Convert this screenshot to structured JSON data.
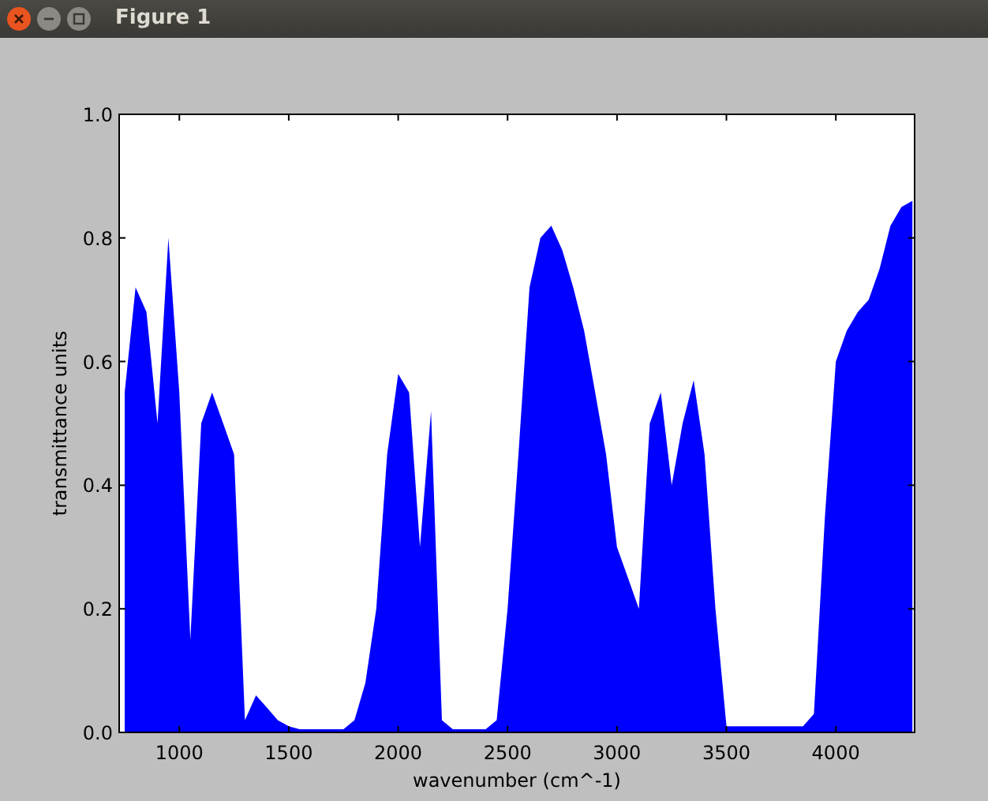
{
  "window": {
    "title": "Figure 1"
  },
  "figure": {
    "chart_data": {
      "type": "area",
      "xlabel": "wavenumber (cm^-1)",
      "ylabel": "transmittance units",
      "xlim": [
        725,
        4360
      ],
      "ylim": [
        0,
        1
      ],
      "xticks": [
        1000,
        1500,
        2000,
        2500,
        3000,
        3500,
        4000
      ],
      "yticks": [
        {
          "value": 0,
          "label": "0.0"
        },
        {
          "value": 0.2,
          "label": "0.2"
        },
        {
          "value": 0.4,
          "label": "0.4"
        },
        {
          "value": 0.6,
          "label": "0.6"
        },
        {
          "value": 0.8,
          "label": "0.8"
        },
        {
          "value": 1,
          "label": "1.0"
        }
      ],
      "x": [
        750,
        800,
        850,
        900,
        950,
        1000,
        1050,
        1100,
        1150,
        1200,
        1250,
        1300,
        1350,
        1400,
        1450,
        1500,
        1550,
        1600,
        1650,
        1700,
        1750,
        1800,
        1850,
        1900,
        1950,
        2000,
        2050,
        2100,
        2150,
        2200,
        2250,
        2300,
        2350,
        2400,
        2450,
        2500,
        2550,
        2600,
        2650,
        2700,
        2750,
        2800,
        2850,
        2900,
        2950,
        3000,
        3050,
        3100,
        3150,
        3200,
        3250,
        3300,
        3350,
        3400,
        3450,
        3500,
        3550,
        3600,
        3650,
        3700,
        3750,
        3800,
        3850,
        3900,
        3950,
        4000,
        4050,
        4100,
        4150,
        4200,
        4250,
        4300,
        4350
      ],
      "series": [
        {
          "color": "#0000ff",
          "values": [
            0.55,
            0.72,
            0.68,
            0.5,
            0.8,
            0.55,
            0.15,
            0.5,
            0.55,
            0.5,
            0.45,
            0.02,
            0.06,
            0.04,
            0.02,
            0.01,
            0.005,
            0.005,
            0.005,
            0.005,
            0.005,
            0.02,
            0.08,
            0.2,
            0.45,
            0.58,
            0.55,
            0.3,
            0.52,
            0.02,
            0.005,
            0.005,
            0.005,
            0.005,
            0.02,
            0.2,
            0.45,
            0.72,
            0.8,
            0.82,
            0.78,
            0.72,
            0.65,
            0.55,
            0.45,
            0.3,
            0.25,
            0.2,
            0.5,
            0.55,
            0.4,
            0.5,
            0.57,
            0.45,
            0.2,
            0.01,
            0.01,
            0.01,
            0.01,
            0.01,
            0.01,
            0.01,
            0.01,
            0.03,
            0.35,
            0.6,
            0.65,
            0.68,
            0.7,
            0.75,
            0.82,
            0.85,
            0.86
          ]
        }
      ]
    }
  }
}
